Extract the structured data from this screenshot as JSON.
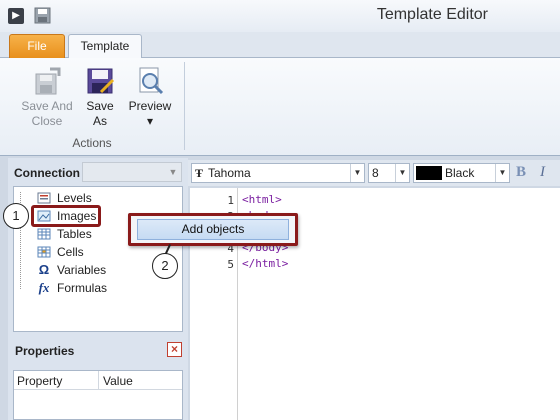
{
  "window": {
    "title": "Template Editor"
  },
  "ribbon": {
    "tabs": [
      {
        "label": "File"
      },
      {
        "label": "Template"
      }
    ],
    "buttons": {
      "save_and_close": {
        "line1": "Save And",
        "line2": "Close",
        "enabled": false
      },
      "save_as": {
        "line1": "Save",
        "line2": "As"
      },
      "preview": {
        "label": "Preview",
        "dropdown": "▾"
      }
    },
    "group_label": "Actions"
  },
  "connection": {
    "label": "Connection",
    "value": ""
  },
  "tree": {
    "items": [
      {
        "label": "Levels",
        "icon": "levels-icon"
      },
      {
        "label": "Images",
        "icon": "images-icon"
      },
      {
        "label": "Tables",
        "icon": "tables-icon"
      },
      {
        "label": "Cells",
        "icon": "cells-icon"
      },
      {
        "label": "Variables",
        "icon": "omega-icon"
      },
      {
        "label": "Formulas",
        "icon": "fx-icon"
      }
    ]
  },
  "properties": {
    "label": "Properties",
    "columns": [
      "Property",
      "Value"
    ]
  },
  "editor_toolbar": {
    "font": "Tahoma",
    "font_icon": "Ŧ",
    "size": "8",
    "color_name": "Black",
    "color_hex": "#000000",
    "bold": "B",
    "italic": "I"
  },
  "code": {
    "lines": [
      {
        "num": "1",
        "text": "<html>"
      },
      {
        "num": "2",
        "text": "<body>"
      },
      {
        "num": "4",
        "text": "</body>"
      },
      {
        "num": "5",
        "text": "</html>"
      }
    ]
  },
  "context_menu": {
    "item": "Add objects"
  },
  "callouts": [
    "1",
    "2"
  ]
}
